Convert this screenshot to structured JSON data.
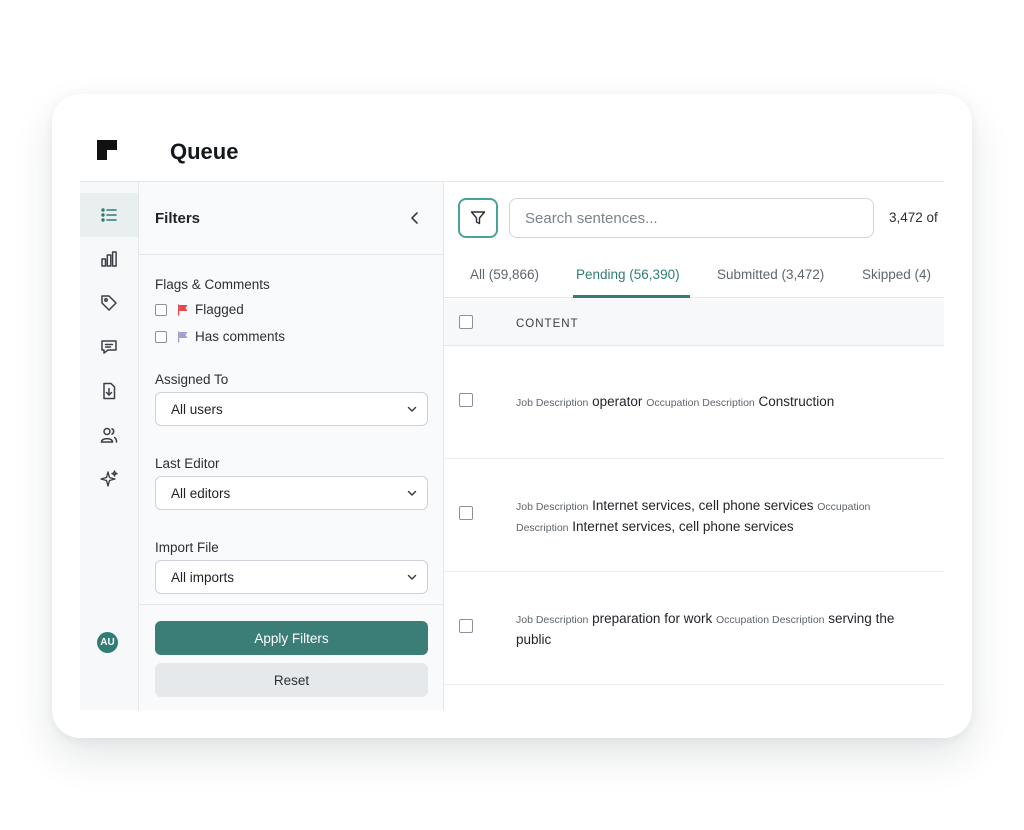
{
  "header": {
    "title": "Queue"
  },
  "rail": {
    "icons": [
      "list-icon",
      "bar-chart-icon",
      "tag-icon",
      "comment-icon",
      "download-icon",
      "users-icon",
      "sparkles-icon"
    ],
    "avatar_initials": "AU",
    "accent": "#2f7d75"
  },
  "filters": {
    "title": "Filters",
    "flags_section": "Flags & Comments",
    "flagged_label": "Flagged",
    "comments_label": "Has comments",
    "assigned_label": "Assigned To",
    "assigned_value": "All users",
    "editor_label": "Last Editor",
    "editor_value": "All editors",
    "import_label": "Import File",
    "import_value": "All imports",
    "apply_label": "Apply Filters",
    "reset_label": "Reset"
  },
  "main": {
    "search_placeholder": "Search sentences...",
    "count_text": "3,472 of",
    "tabs": [
      {
        "label": "All (59,866)"
      },
      {
        "label": "Pending (56,390)"
      },
      {
        "label": "Submitted (3,472)"
      },
      {
        "label": "Skipped (4)"
      }
    ],
    "column_content": "CONTENT",
    "rows": [
      {
        "job_label": "Job Description",
        "job": "operator",
        "occ_label": "Occupation Description",
        "occ": "Construction"
      },
      {
        "job_label": "Job Description",
        "job": "Internet services, cell phone services",
        "occ_label": "Occupation Description",
        "occ": "Internet services, cell phone services"
      },
      {
        "job_label": "Job Description",
        "job": "preparation for work",
        "occ_label": "Occupation Description",
        "occ": "serving the public"
      }
    ]
  }
}
